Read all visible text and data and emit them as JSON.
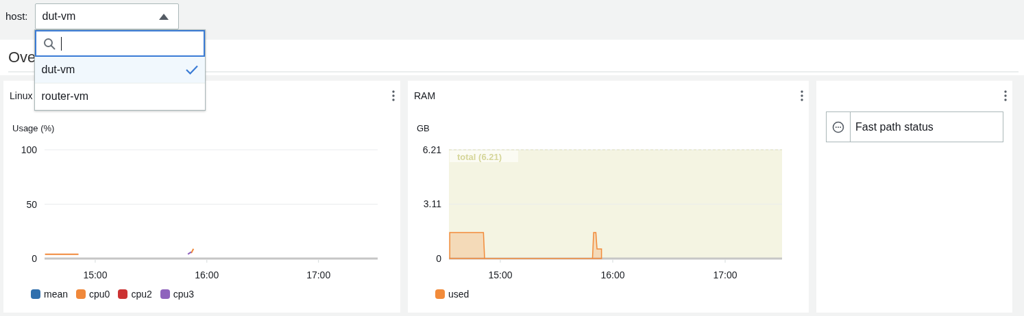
{
  "toolbar": {
    "host_label": "host:",
    "host_select": {
      "value": "dut-vm",
      "expanded": true
    }
  },
  "host_dropdown": {
    "options": [
      {
        "label": "dut-vm",
        "selected": true
      },
      {
        "label": "router-vm",
        "selected": false
      }
    ]
  },
  "page_heading": "Ove",
  "widgets": [
    {
      "kind": "chart",
      "title": "Linux",
      "chart_data": {
        "type": "line",
        "ylabel": "Usage (%)",
        "x": [
          14.55,
          14.6,
          14.65,
          14.7,
          14.75,
          14.8,
          14.85,
          15.83,
          15.86,
          15.88
        ],
        "xlim": [
          14.546,
          17.53
        ],
        "ylim": [
          0,
          100
        ],
        "yticks": [
          0,
          50,
          100
        ],
        "xticks": [
          {
            "value": 15,
            "label": "15:00"
          },
          {
            "value": 16,
            "label": "16:00"
          },
          {
            "value": 17,
            "label": "17:00"
          }
        ],
        "series": [
          {
            "name": "mean",
            "color": "#2f6fad",
            "values": [
              null,
              null,
              null,
              null,
              null,
              null,
              null,
              null,
              null,
              null
            ]
          },
          {
            "name": "cpu0",
            "color": "#f0883a",
            "values": [
              4,
              4,
              4,
              4,
              4,
              4,
              4,
              null,
              5,
              9
            ]
          },
          {
            "name": "cpu2",
            "color": "#cc3333",
            "values": [
              null,
              null,
              null,
              null,
              null,
              null,
              null,
              null,
              null,
              null
            ]
          },
          {
            "name": "cpu3",
            "color": "#8f63bd",
            "values": [
              null,
              null,
              null,
              null,
              null,
              null,
              null,
              4,
              6,
              null
            ]
          }
        ]
      }
    },
    {
      "kind": "chart",
      "title": "RAM",
      "chart_data": {
        "type": "area",
        "ylabel": "GB",
        "x": [
          14.55,
          14.6,
          14.65,
          14.7,
          14.75,
          14.8,
          14.85,
          14.86,
          15.82,
          15.83,
          15.85,
          15.86,
          15.9
        ],
        "xlim": [
          14.543,
          17.506
        ],
        "ylim": [
          0,
          6.21
        ],
        "yticks": [
          0,
          3.11,
          6.21
        ],
        "xticks": [
          {
            "value": 15,
            "label": "15:00"
          },
          {
            "value": 16,
            "label": "16:00"
          },
          {
            "value": 17,
            "label": "17:00"
          }
        ],
        "ref_lines": [
          {
            "label": "total (6.21)"
          }
        ],
        "series": [
          {
            "name": "used",
            "color": "#f28b3a",
            "values": [
              1.48,
              1.48,
              1.48,
              1.48,
              1.48,
              1.48,
              1.48,
              0,
              0,
              1.48,
              1.48,
              0.55,
              0.55
            ]
          }
        ]
      }
    },
    {
      "kind": "status",
      "items": [
        {
          "label": "Fast path status"
        }
      ]
    }
  ]
}
